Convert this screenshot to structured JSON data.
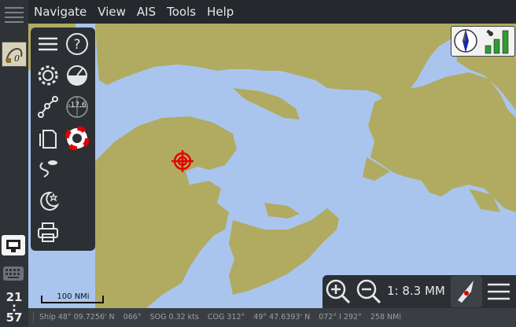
{
  "menubar": {
    "items": [
      "Navigate",
      "View",
      "AIS",
      "Tools",
      "Help"
    ]
  },
  "clock": {
    "hours": "21",
    "separator": ":",
    "minutes": "57"
  },
  "toolbar": {
    "buttons": [
      "menu",
      "help",
      "settings",
      "dashboard",
      "route",
      "compass-rose",
      "layers",
      "mob",
      "track",
      "night-mode",
      "print"
    ],
    "compass_value": "-17.6"
  },
  "scale": {
    "label": "100 NMi",
    "ratio": "1: 8.3 MM"
  },
  "statusbar": {
    "ship": "Ship 48° 09.7256' N",
    "heading": "066°",
    "sog": "SOG 0.32 kts",
    "cog": "COG 312°",
    "cursor": "49° 47.6393' N",
    "bearing": "072° I  292° ",
    "distance": "258 NMi"
  },
  "colors": {
    "land": "#b0ab60",
    "water": "#a9c5ee",
    "panel": "#2c3034",
    "ownship": "#e60000"
  }
}
